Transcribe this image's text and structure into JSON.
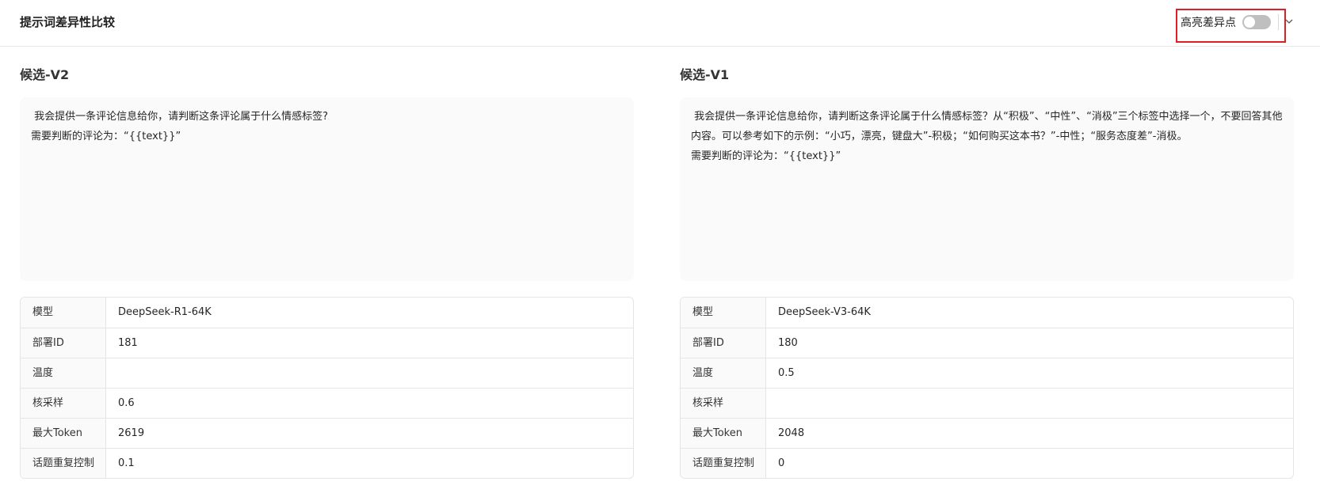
{
  "header": {
    "title": "提示词差异性比较",
    "highlight_label": "高亮差异点",
    "highlight_on": false,
    "chevron_icon": "chevron-down-icon"
  },
  "left": {
    "title": "候选-V2",
    "prompt": " 我会提供一条评论信息给你，请判断这条评论属于什么情感标签?\n需要判断的评论为：“{{text}}”",
    "params": [
      {
        "key": "模型",
        "value": "DeepSeek-R1-64K"
      },
      {
        "key": "部署ID",
        "value": "181"
      },
      {
        "key": "温度",
        "value": ""
      },
      {
        "key": "核采样",
        "value": "0.6"
      },
      {
        "key": "最大Token",
        "value": "2619"
      },
      {
        "key": "话题重复控制",
        "value": "0.1"
      }
    ]
  },
  "right": {
    "title": "候选-V1",
    "prompt": " 我会提供一条评论信息给你，请判断这条评论属于什么情感标签？从“积极”、“中性”、“消极”三个标签中选择一个，不要回答其他内容。可以参考如下的示例：“小巧，漂亮，键盘大”-积极；“如何购买这本书？”-中性；“服务态度差”-消极。\n需要判断的评论为：“{{text}}”",
    "params": [
      {
        "key": "模型",
        "value": "DeepSeek-V3-64K"
      },
      {
        "key": "部署ID",
        "value": "180"
      },
      {
        "key": "温度",
        "value": "0.5"
      },
      {
        "key": "核采样",
        "value": ""
      },
      {
        "key": "最大Token",
        "value": "2048"
      },
      {
        "key": "话题重复控制",
        "value": "0"
      }
    ]
  }
}
